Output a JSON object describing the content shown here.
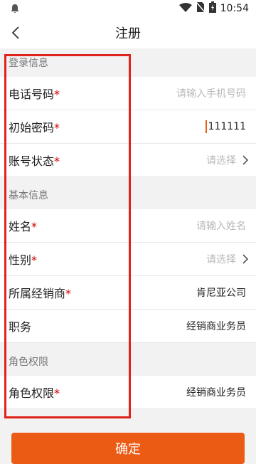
{
  "status_bar": {
    "time": "10:54"
  },
  "nav": {
    "title": "注册"
  },
  "sections": {
    "login_info": "登录信息",
    "basic_info": "基本信息",
    "role": "角色权限"
  },
  "fields": {
    "phone": {
      "label": "电话号码",
      "required": "*",
      "placeholder": "请输入手机号码"
    },
    "password": {
      "label": "初始密码",
      "required": "*",
      "value": "111111"
    },
    "status": {
      "label": "账号状态",
      "required": "*",
      "placeholder": "请选择"
    },
    "name": {
      "label": "姓名",
      "required": "*",
      "placeholder": "请输入姓名"
    },
    "gender": {
      "label": "性别",
      "required": "*",
      "placeholder": "请选择"
    },
    "dealer": {
      "label": "所属经销商",
      "required": "*",
      "value": "肯尼亚公司"
    },
    "position": {
      "label": "职务",
      "value": "经销商业务员"
    },
    "role": {
      "label": "角色权限",
      "required": "*",
      "value": "经销商业务员"
    }
  },
  "confirm_button": {
    "label": "确定"
  },
  "colors": {
    "accent": "#ec5b14",
    "required": "#d20000",
    "highlight": "#e0221a"
  }
}
